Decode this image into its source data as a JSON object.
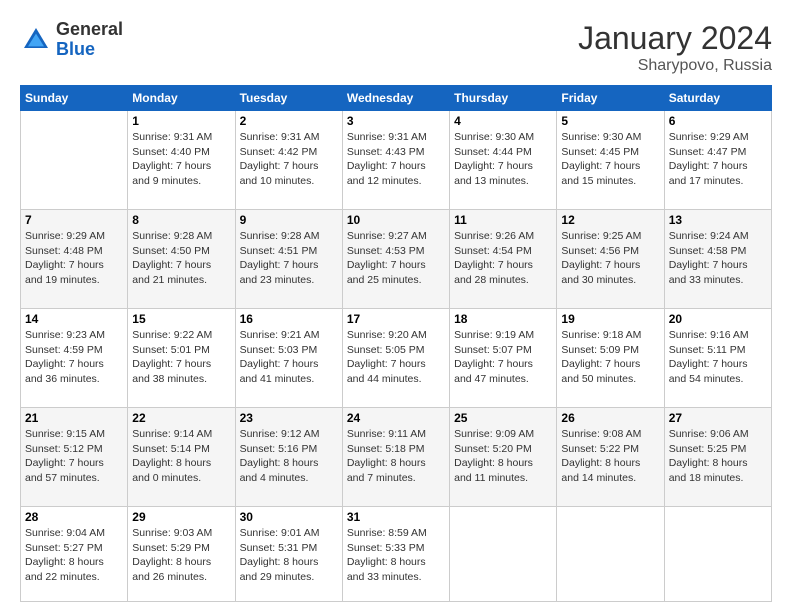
{
  "logo": {
    "general": "General",
    "blue": "Blue"
  },
  "title": "January 2024",
  "location": "Sharypovo, Russia",
  "days_header": [
    "Sunday",
    "Monday",
    "Tuesday",
    "Wednesday",
    "Thursday",
    "Friday",
    "Saturday"
  ],
  "weeks": [
    [
      {
        "day": "",
        "info": ""
      },
      {
        "day": "1",
        "info": "Sunrise: 9:31 AM\nSunset: 4:40 PM\nDaylight: 7 hours\nand 9 minutes."
      },
      {
        "day": "2",
        "info": "Sunrise: 9:31 AM\nSunset: 4:42 PM\nDaylight: 7 hours\nand 10 minutes."
      },
      {
        "day": "3",
        "info": "Sunrise: 9:31 AM\nSunset: 4:43 PM\nDaylight: 7 hours\nand 12 minutes."
      },
      {
        "day": "4",
        "info": "Sunrise: 9:30 AM\nSunset: 4:44 PM\nDaylight: 7 hours\nand 13 minutes."
      },
      {
        "day": "5",
        "info": "Sunrise: 9:30 AM\nSunset: 4:45 PM\nDaylight: 7 hours\nand 15 minutes."
      },
      {
        "day": "6",
        "info": "Sunrise: 9:29 AM\nSunset: 4:47 PM\nDaylight: 7 hours\nand 17 minutes."
      }
    ],
    [
      {
        "day": "7",
        "info": "Sunrise: 9:29 AM\nSunset: 4:48 PM\nDaylight: 7 hours\nand 19 minutes."
      },
      {
        "day": "8",
        "info": "Sunrise: 9:28 AM\nSunset: 4:50 PM\nDaylight: 7 hours\nand 21 minutes."
      },
      {
        "day": "9",
        "info": "Sunrise: 9:28 AM\nSunset: 4:51 PM\nDaylight: 7 hours\nand 23 minutes."
      },
      {
        "day": "10",
        "info": "Sunrise: 9:27 AM\nSunset: 4:53 PM\nDaylight: 7 hours\nand 25 minutes."
      },
      {
        "day": "11",
        "info": "Sunrise: 9:26 AM\nSunset: 4:54 PM\nDaylight: 7 hours\nand 28 minutes."
      },
      {
        "day": "12",
        "info": "Sunrise: 9:25 AM\nSunset: 4:56 PM\nDaylight: 7 hours\nand 30 minutes."
      },
      {
        "day": "13",
        "info": "Sunrise: 9:24 AM\nSunset: 4:58 PM\nDaylight: 7 hours\nand 33 minutes."
      }
    ],
    [
      {
        "day": "14",
        "info": "Sunrise: 9:23 AM\nSunset: 4:59 PM\nDaylight: 7 hours\nand 36 minutes."
      },
      {
        "day": "15",
        "info": "Sunrise: 9:22 AM\nSunset: 5:01 PM\nDaylight: 7 hours\nand 38 minutes."
      },
      {
        "day": "16",
        "info": "Sunrise: 9:21 AM\nSunset: 5:03 PM\nDaylight: 7 hours\nand 41 minutes."
      },
      {
        "day": "17",
        "info": "Sunrise: 9:20 AM\nSunset: 5:05 PM\nDaylight: 7 hours\nand 44 minutes."
      },
      {
        "day": "18",
        "info": "Sunrise: 9:19 AM\nSunset: 5:07 PM\nDaylight: 7 hours\nand 47 minutes."
      },
      {
        "day": "19",
        "info": "Sunrise: 9:18 AM\nSunset: 5:09 PM\nDaylight: 7 hours\nand 50 minutes."
      },
      {
        "day": "20",
        "info": "Sunrise: 9:16 AM\nSunset: 5:11 PM\nDaylight: 7 hours\nand 54 minutes."
      }
    ],
    [
      {
        "day": "21",
        "info": "Sunrise: 9:15 AM\nSunset: 5:12 PM\nDaylight: 7 hours\nand 57 minutes."
      },
      {
        "day": "22",
        "info": "Sunrise: 9:14 AM\nSunset: 5:14 PM\nDaylight: 8 hours\nand 0 minutes."
      },
      {
        "day": "23",
        "info": "Sunrise: 9:12 AM\nSunset: 5:16 PM\nDaylight: 8 hours\nand 4 minutes."
      },
      {
        "day": "24",
        "info": "Sunrise: 9:11 AM\nSunset: 5:18 PM\nDaylight: 8 hours\nand 7 minutes."
      },
      {
        "day": "25",
        "info": "Sunrise: 9:09 AM\nSunset: 5:20 PM\nDaylight: 8 hours\nand 11 minutes."
      },
      {
        "day": "26",
        "info": "Sunrise: 9:08 AM\nSunset: 5:22 PM\nDaylight: 8 hours\nand 14 minutes."
      },
      {
        "day": "27",
        "info": "Sunrise: 9:06 AM\nSunset: 5:25 PM\nDaylight: 8 hours\nand 18 minutes."
      }
    ],
    [
      {
        "day": "28",
        "info": "Sunrise: 9:04 AM\nSunset: 5:27 PM\nDaylight: 8 hours\nand 22 minutes."
      },
      {
        "day": "29",
        "info": "Sunrise: 9:03 AM\nSunset: 5:29 PM\nDaylight: 8 hours\nand 26 minutes."
      },
      {
        "day": "30",
        "info": "Sunrise: 9:01 AM\nSunset: 5:31 PM\nDaylight: 8 hours\nand 29 minutes."
      },
      {
        "day": "31",
        "info": "Sunrise: 8:59 AM\nSunset: 5:33 PM\nDaylight: 8 hours\nand 33 minutes."
      },
      {
        "day": "",
        "info": ""
      },
      {
        "day": "",
        "info": ""
      },
      {
        "day": "",
        "info": ""
      }
    ]
  ]
}
